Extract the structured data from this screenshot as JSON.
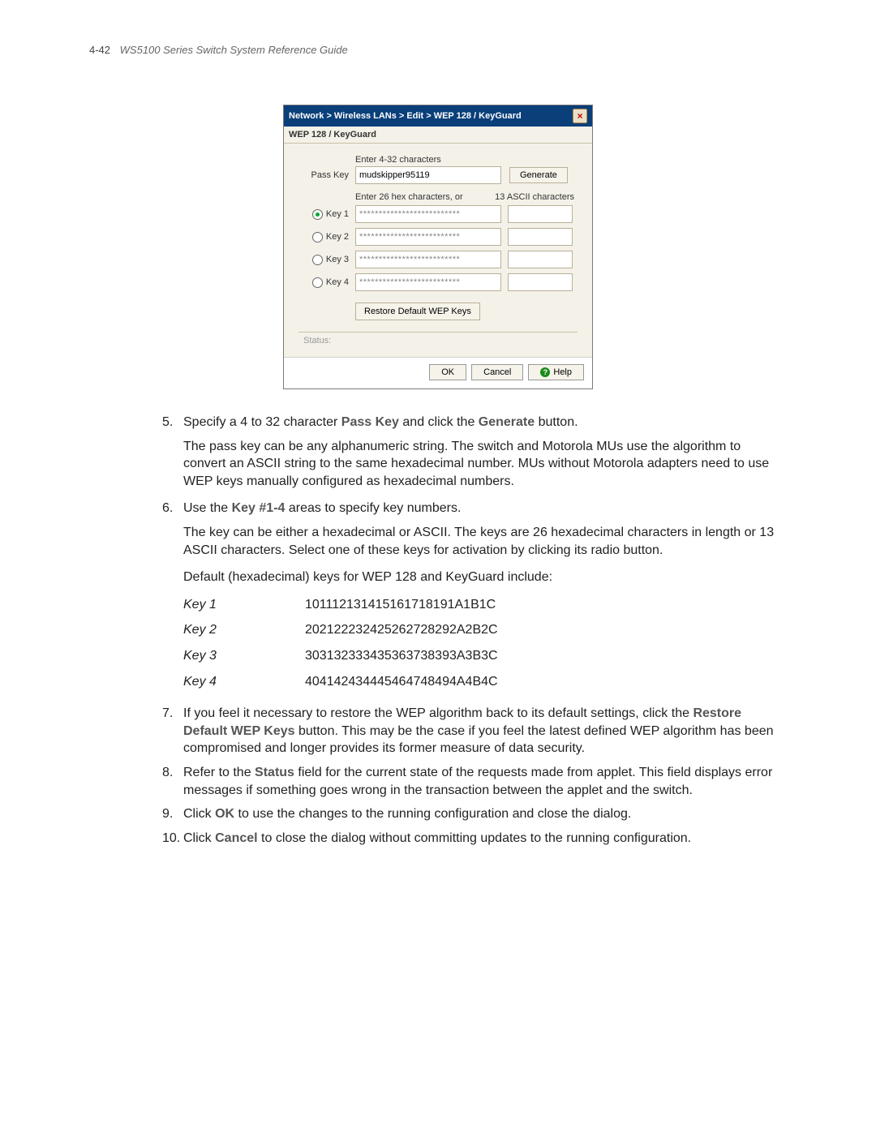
{
  "header": {
    "page_number": "4-42",
    "doc_title": "WS5100 Series Switch System Reference Guide"
  },
  "dialog": {
    "breadcrumb": "Network > Wireless LANs > Edit > WEP 128 / KeyGuard",
    "section_label": "WEP 128 / KeyGuard",
    "passkey_hint": "Enter 4-32 characters",
    "passkey_label": "Pass Key",
    "passkey_value": "mudskipper95119",
    "generate_label": "Generate",
    "hex_hint": "Enter 26 hex characters, or",
    "ascii_hint": "13 ASCII characters",
    "keys": [
      {
        "label": "Key 1",
        "masked": "**************************",
        "checked": true
      },
      {
        "label": "Key 2",
        "masked": "**************************",
        "checked": false
      },
      {
        "label": "Key 3",
        "masked": "**************************",
        "checked": false
      },
      {
        "label": "Key 4",
        "masked": "**************************",
        "checked": false
      }
    ],
    "restore_label": "Restore Default WEP Keys",
    "status_label": "Status:",
    "ok_label": "OK",
    "cancel_label": "Cancel",
    "help_label": "Help"
  },
  "steps": {
    "s5_num": "5.",
    "s5_a": "Specify a 4 to 32 character ",
    "s5_b": "Pass Key",
    "s5_c": " and click the ",
    "s5_d": "Generate",
    "s5_e": " button.",
    "s5_follow": "The pass key can be any alphanumeric string. The switch and Motorola MUs use the algorithm to convert an ASCII string to the same hexadecimal number. MUs without Motorola adapters need to use WEP keys manually configured as hexadecimal numbers.",
    "s6_num": "6.",
    "s6_a": "Use the ",
    "s6_b": "Key #1-4",
    "s6_c": " areas to specify key numbers.",
    "s6_follow1": "The key can be either a hexadecimal or ASCII. The keys are 26 hexadecimal characters in length or 13 ASCII characters. Select one of these keys for activation by clicking its radio button.",
    "s6_follow2": "Default (hexadecimal) keys for WEP 128 and KeyGuard include:",
    "s7_num": "7.",
    "s7_a": "If you feel it necessary to restore the WEP algorithm back to its default settings, click the ",
    "s7_b": "Restore Default WEP Keys",
    "s7_c": " button. This may be the case if you feel the latest defined WEP algorithm has been compromised and longer provides its former measure of data security.",
    "s8_num": "8.",
    "s8_a": "Refer to the ",
    "s8_b": "Status",
    "s8_c": " field for the current state of the requests made from applet. This field displays error messages if something goes wrong in the transaction between the applet and the switch.",
    "s9_num": "9.",
    "s9_a": "Click ",
    "s9_b": "OK",
    "s9_c": " to use the changes to the running configuration and close the dialog.",
    "s10_num": "10.",
    "s10_a": "Click ",
    "s10_b": "Cancel",
    "s10_c": " to close the dialog without committing updates to the running configuration."
  },
  "key_table": [
    {
      "label": "Key 1",
      "value": "101112131415161718191A1B1C"
    },
    {
      "label": "Key 2",
      "value": "202122232425262728292A2B2C"
    },
    {
      "label": "Key 3",
      "value": "303132333435363738393A3B3C"
    },
    {
      "label": "Key 4",
      "value": "404142434445464748494A4B4C"
    }
  ]
}
